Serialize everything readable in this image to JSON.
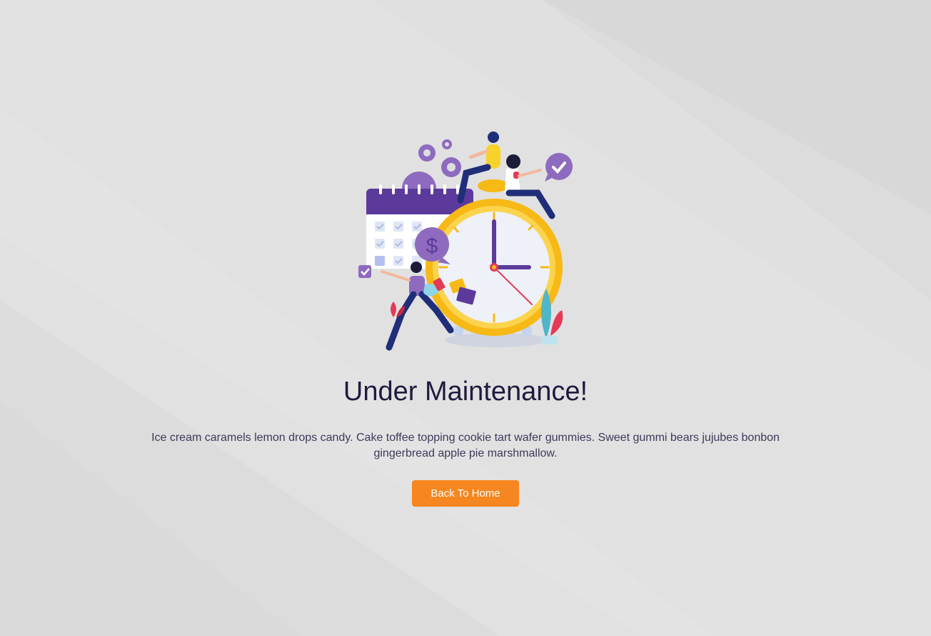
{
  "page": {
    "title": "Under Maintenance!",
    "description": "Ice cream caramels lemon drops candy. Cake toffee topping cookie tart wafer gummies. Sweet gummi bears jujubes bonbon gingerbread apple pie marshmallow.",
    "button_label": "Back To Home"
  },
  "illustration": {
    "icon": "maintenance-clock-illustration",
    "dollar_symbol": "$",
    "colors": {
      "purple": "#5b3a9b",
      "light_purple": "#8e6bbf",
      "clock_yellow": "#f6b916",
      "clock_face": "#eef1f8",
      "accent_red": "#e53a57",
      "teal": "#4fb6c9",
      "navy": "#1f2e78"
    }
  },
  "theme": {
    "background": "#dedede",
    "title_color": "#1e1b3f",
    "text_color": "#3d3a5a",
    "button_color": "#f6861f"
  }
}
